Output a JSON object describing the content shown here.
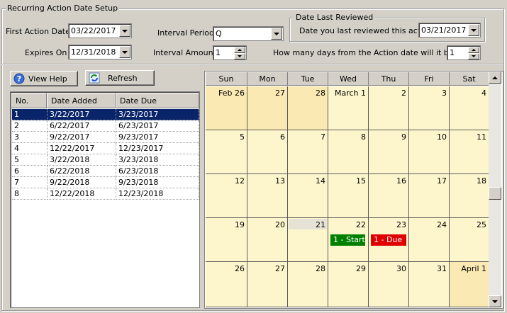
{
  "setup": {
    "group_title": "Recurring Action Date Setup",
    "first_action_label": "First Action Date",
    "first_action_value": "03/22/2017",
    "expires_label": "Expires On",
    "expires_value": "12/31/2018",
    "interval_period_label": "Interval Period",
    "interval_period_value": "Q",
    "interval_amount_label": "Interval Amount",
    "interval_amount_value": "1",
    "review_group_title": "Date Last Reviewed",
    "review_label": "Date you last reviewed this action.",
    "review_value": "03/21/2017",
    "due_days_label": "How many days from the Action date will it be due",
    "due_days_value": "1"
  },
  "toolbar": {
    "view_help_label": "View Help",
    "refresh_label": "Refresh"
  },
  "table": {
    "columns": [
      "No.",
      "Date Added",
      "Date Due"
    ],
    "rows": [
      [
        "1",
        "3/22/2017",
        "3/23/2017"
      ],
      [
        "2",
        "6/22/2017",
        "6/23/2017"
      ],
      [
        "3",
        "9/22/2017",
        "9/23/2017"
      ],
      [
        "4",
        "12/22/2017",
        "12/23/2017"
      ],
      [
        "5",
        "3/22/2018",
        "3/23/2018"
      ],
      [
        "6",
        "6/22/2018",
        "6/23/2018"
      ],
      [
        "7",
        "9/22/2018",
        "9/23/2018"
      ],
      [
        "8",
        "12/22/2018",
        "12/23/2018"
      ]
    ],
    "selected_row": 0
  },
  "calendar": {
    "days": [
      "Sun",
      "Mon",
      "Tue",
      "Wed",
      "Thu",
      "Fri",
      "Sat"
    ],
    "weeks": [
      [
        "Feb 26",
        "27",
        "28",
        "March 1",
        "2",
        "3",
        "4"
      ],
      [
        "5",
        "6",
        "7",
        "8",
        "9",
        "10",
        "11"
      ],
      [
        "12",
        "13",
        "14",
        "15",
        "16",
        "17",
        "18"
      ],
      [
        "19",
        "20",
        "21",
        "22",
        "23",
        "24",
        "25"
      ],
      [
        "26",
        "27",
        "28",
        "29",
        "30",
        "31",
        "April 1"
      ]
    ],
    "events": {
      "start_label": "1 - Start",
      "start_color": "#008000",
      "due_label": "1 - Due",
      "due_color": "#e00000"
    },
    "cell_color": "#fdf6cc",
    "out_month_color": "#fbe9b3"
  }
}
